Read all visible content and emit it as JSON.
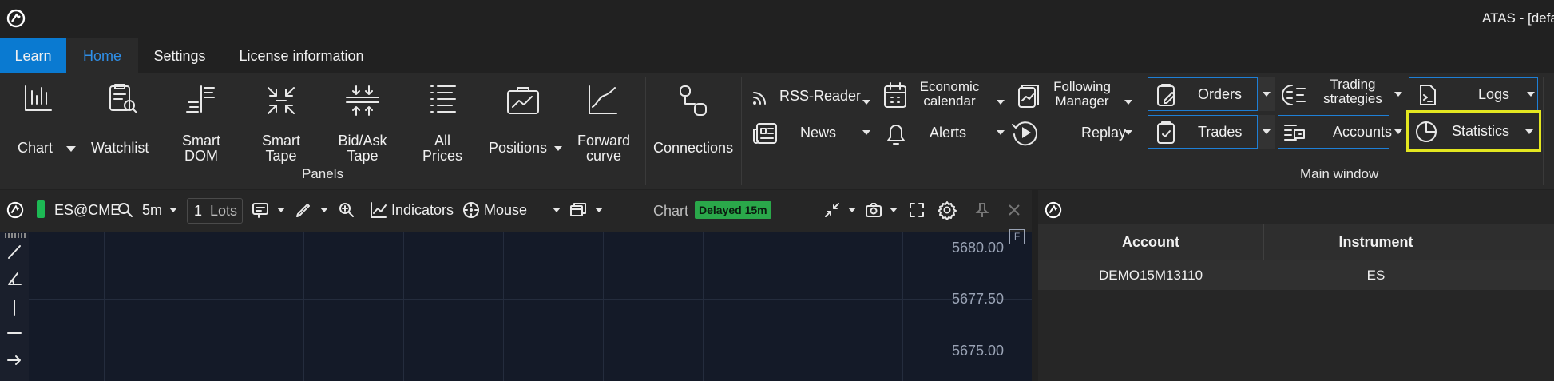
{
  "title_bar": {
    "title": "ATAS - [defa"
  },
  "menu_tabs": [
    {
      "label": "Learn"
    },
    {
      "label": "Home"
    },
    {
      "label": "Settings"
    },
    {
      "label": "License information"
    }
  ],
  "panels": {
    "group_label": "Panels",
    "chart": "Chart",
    "watchlist": "Watchlist",
    "smart_dom": [
      "Smart",
      "DOM"
    ],
    "smart_tape": [
      "Smart",
      "Tape"
    ],
    "bid_ask_tape": [
      "Bid/Ask",
      "Tape"
    ],
    "all_prices": [
      "All",
      "Prices"
    ],
    "positions": "Positions",
    "forward_curve": [
      "Forward",
      "curve"
    ],
    "connections": "Connections"
  },
  "tools": {
    "rss_reader": "RSS-Reader",
    "economic_calendar": [
      "Economic",
      "calendar"
    ],
    "following_manager": [
      "Following",
      "Manager"
    ],
    "news": "News",
    "alerts": "Alerts",
    "replay": "Replay"
  },
  "main_window": {
    "group_label": "Main window",
    "orders": "Orders",
    "trading_strategies": [
      "Trading",
      "strategies"
    ],
    "logs": "Logs",
    "trades": "Trades",
    "accounts": "Accounts",
    "statistics": "Statistics"
  },
  "chart_toolbar": {
    "instrument": "ES@CME",
    "timeframe": "5m",
    "lots_value": "1",
    "lots_label": "Lots",
    "indicators": "Indicators",
    "mouse": "Mouse",
    "chart_label": "Chart",
    "delayed_badge": "Delayed 15m"
  },
  "chart": {
    "price_levels": [
      "5680.00",
      "5677.50",
      "5675.00"
    ],
    "f_marker": "F"
  },
  "accounts_table": {
    "columns": [
      "Account",
      "Instrument"
    ],
    "rows": [
      [
        "DEMO15M13110",
        "ES"
      ]
    ]
  },
  "colors": {
    "accent_blue": "#0a7ad1",
    "highlight_yellow": "#e3e620",
    "delayed_green": "#2aa84a",
    "background": "#212121",
    "chart_bg": "#141a28"
  }
}
